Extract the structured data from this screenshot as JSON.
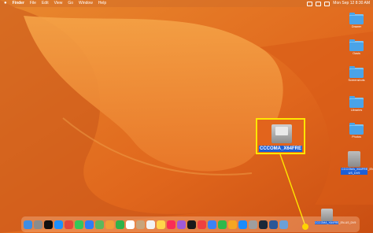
{
  "menubar": {
    "apple": "",
    "app_name": "Finder",
    "items": [
      "File",
      "Edit",
      "View",
      "Go",
      "Window",
      "Help"
    ],
    "clock": "Mon Sep 12  8:30 AM"
  },
  "desktop": {
    "folders": [
      {
        "label": "Drawer"
      },
      {
        "label": "Oasis"
      },
      {
        "label": "Screenshots"
      },
      {
        "label": "Libraries"
      },
      {
        "label": "Photos"
      }
    ],
    "disk_label": "CCCOMA_X64FRE_EN-US_DV9"
  },
  "highlight": {
    "label": "CCCOMA_X64FRE",
    "border_color": "#ffe600"
  },
  "dock": {
    "apps": [
      {
        "name": "finder",
        "color": "#3d8de4"
      },
      {
        "name": "launchpad",
        "color": "#8c8c8c"
      },
      {
        "name": "appletv",
        "color": "#111111"
      },
      {
        "name": "safari",
        "color": "#1e90ff"
      },
      {
        "name": "chrome",
        "color": "#e4473c"
      },
      {
        "name": "messages",
        "color": "#34c759"
      },
      {
        "name": "mail",
        "color": "#2f7cf6"
      },
      {
        "name": "maps",
        "color": "#5cb85c"
      },
      {
        "name": "photos",
        "color": "#f29d38"
      },
      {
        "name": "facetime",
        "color": "#2fb34a"
      },
      {
        "name": "calendar",
        "color": "#ffffff"
      },
      {
        "name": "contacts",
        "color": "#c8a47a"
      },
      {
        "name": "reminders",
        "color": "#f2f2f2"
      },
      {
        "name": "notes",
        "color": "#ffd54a"
      },
      {
        "name": "music",
        "color": "#fa2d55"
      },
      {
        "name": "podcasts",
        "color": "#a05ad8"
      },
      {
        "name": "tv",
        "color": "#1a1a1a"
      },
      {
        "name": "news",
        "color": "#f04040"
      },
      {
        "name": "keynote",
        "color": "#3b82f6"
      },
      {
        "name": "numbers",
        "color": "#2db84b"
      },
      {
        "name": "pages",
        "color": "#f5a623"
      },
      {
        "name": "appstore",
        "color": "#1a8cff"
      },
      {
        "name": "settings",
        "color": "#9e9e9e"
      },
      {
        "name": "steam",
        "color": "#1b2838"
      },
      {
        "name": "word",
        "color": "#2b5797"
      },
      {
        "name": "preview",
        "color": "#6aa0d8"
      }
    ],
    "disk_label": "CCCOMA_X64FRE_EN-US_DV9",
    "trash_label": ""
  }
}
